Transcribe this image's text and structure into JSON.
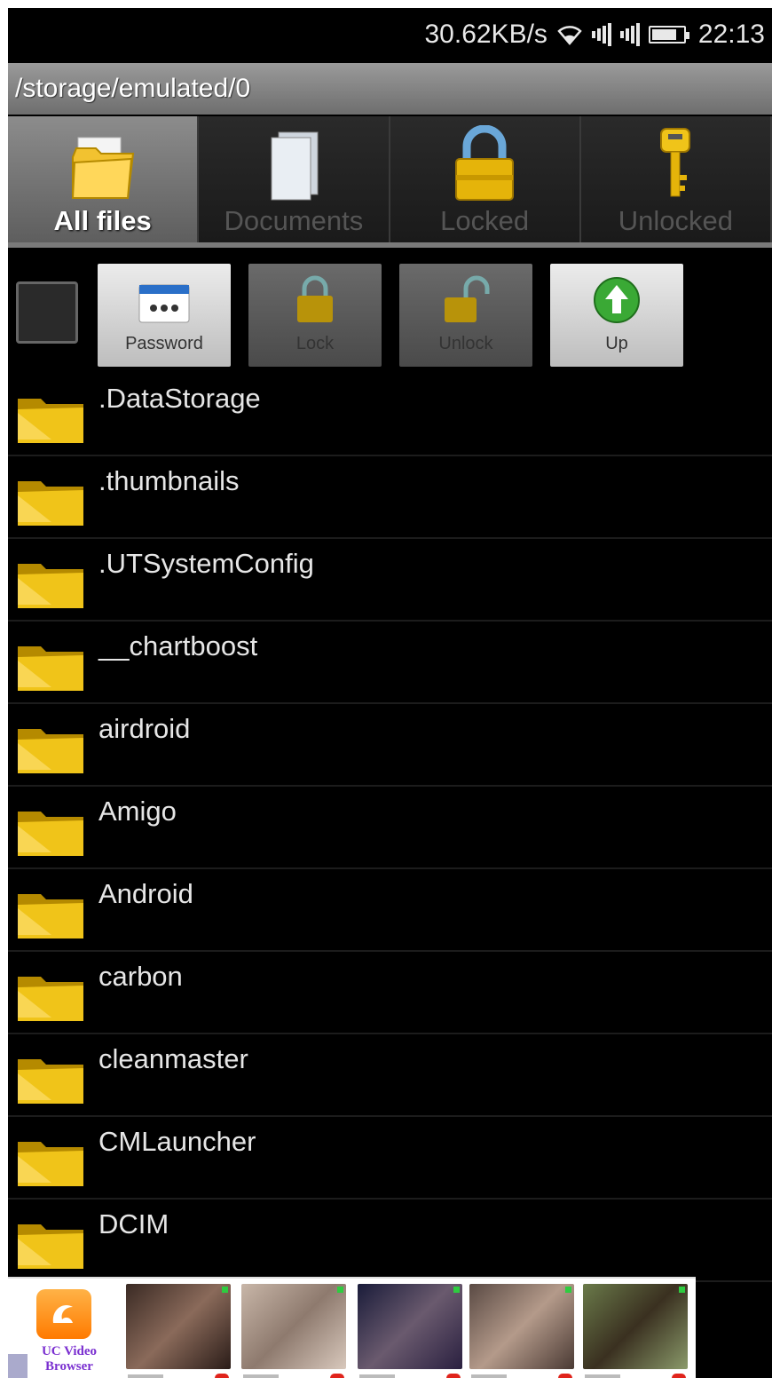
{
  "status_bar": {
    "speed": "30.62KB/s",
    "time": "22:13",
    "icons": [
      "wifi-icon",
      "signal-icon",
      "signal-icon",
      "battery-icon"
    ]
  },
  "path": "/storage/emulated/0",
  "tabs": [
    {
      "label": "All files",
      "icon": "folder-icon",
      "active": true
    },
    {
      "label": "Documents",
      "icon": "documents-icon",
      "active": false
    },
    {
      "label": "Locked",
      "icon": "lock-icon",
      "active": false
    },
    {
      "label": "Unlocked",
      "icon": "key-icon",
      "active": false
    }
  ],
  "toolbar": {
    "password_label": "Password",
    "lock_label": "Lock",
    "unlock_label": "Unlock",
    "up_label": "Up"
  },
  "files": [
    ".DataStorage",
    ".thumbnails",
    ".UTSystemConfig",
    "__chartboost",
    "airdroid",
    "Amigo",
    "Android",
    "carbon",
    "cleanmaster",
    "CMLauncher",
    "DCIM"
  ],
  "ad": {
    "app_name": "UC Video Browser",
    "colors": {
      "brand": "#ff7a00",
      "name": "#7a2fd0"
    }
  },
  "colors": {
    "folder": "#e6b800",
    "tab_active": "#7a7a7a",
    "background": "#000000"
  }
}
